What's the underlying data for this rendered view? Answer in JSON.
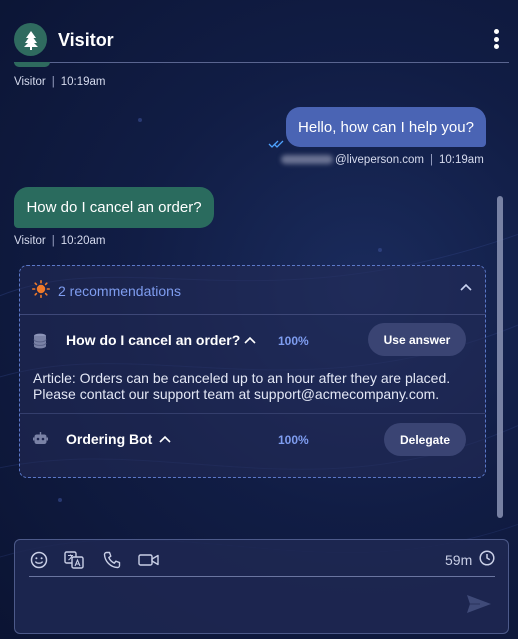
{
  "header": {
    "title": "Visitor",
    "avatar_icon": "pine-tree-icon",
    "menu_icon": "kebab-menu-icon"
  },
  "messages": [
    {
      "sender": "Visitor",
      "time": "10:19am"
    },
    {
      "text": "Hello, how can I help you?",
      "sender_domain": "@liveperson.com",
      "time": "10:19am",
      "status_icon": "read-double-check-icon"
    },
    {
      "text": "How do I cancel an order?",
      "sender": "Visitor",
      "time": "10:20am"
    }
  ],
  "recommendations": {
    "title": "2 recommendations",
    "items": [
      {
        "icon": "database-icon",
        "title": "How do I cancel an order?",
        "confidence": "100%",
        "action_label": "Use answer",
        "body": "Article: Orders can be canceled up to an hour after they are placed. Please contact our support team at support@acmecompany.com."
      },
      {
        "icon": "bot-icon",
        "title": "Ordering Bot",
        "confidence": "100%",
        "action_label": "Delegate"
      }
    ]
  },
  "composer": {
    "timer": "59m",
    "placeholder": "",
    "tools": [
      "emoji-icon",
      "translate-icon",
      "phone-icon",
      "video-icon"
    ]
  },
  "colors": {
    "visitor_bubble": "#2a6b5e",
    "agent_bubble": "#4a64b4",
    "accent": "#7f9df0",
    "background": "#111d45"
  }
}
